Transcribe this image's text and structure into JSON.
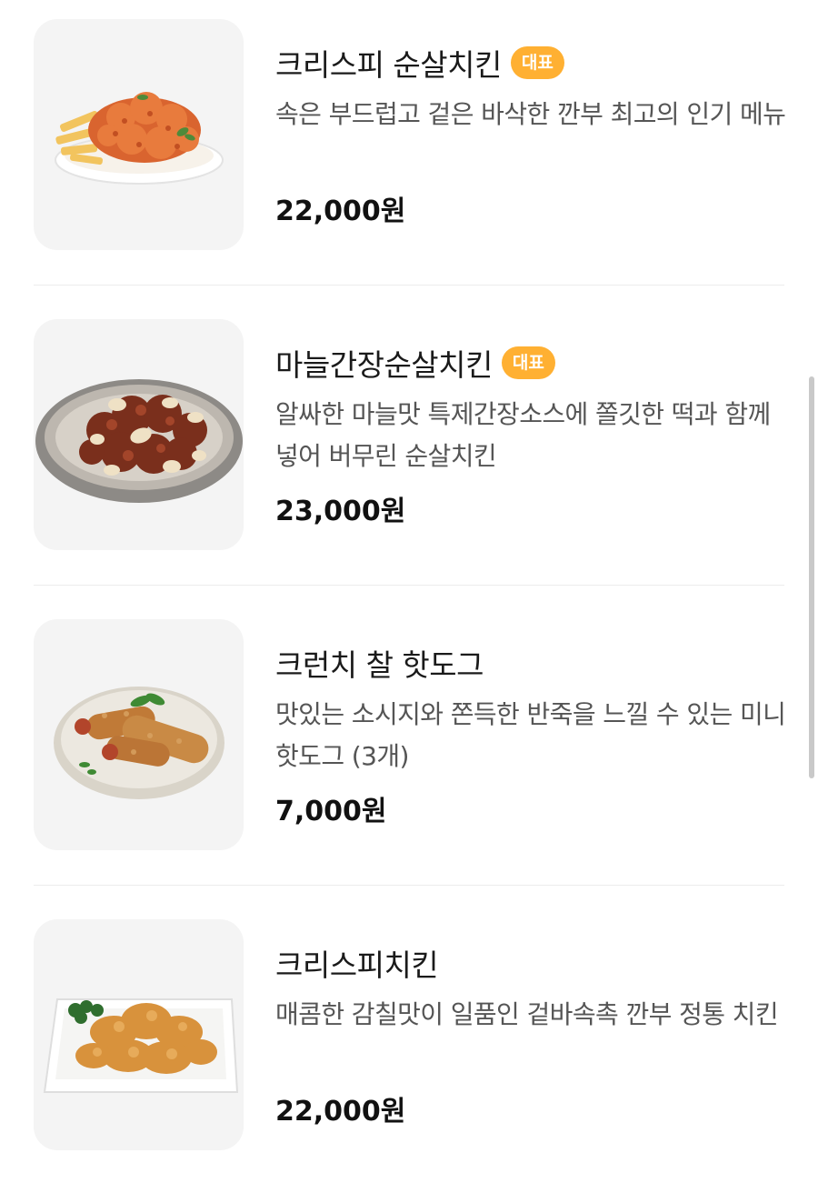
{
  "menu": {
    "items": [
      {
        "name": "크리스피 순살치킨",
        "badge": "대표",
        "description": "속은 부드럽고 겉은 바삭한 깐부 최고의 인기 메뉴",
        "price": "22,000원",
        "image_icon": "crispy-boneless-chicken-image"
      },
      {
        "name": "마늘간장순살치킨",
        "badge": "대표",
        "description": "알싸한 마늘맛 특제간장소스에 쫄깃한 떡과 함께 넣어 버무린 순살치킨",
        "price": "23,000원",
        "image_icon": "garlic-soy-boneless-chicken-image"
      },
      {
        "name": "크런치 찰 핫도그",
        "badge": "",
        "description": "맛있는 소시지와 쫀득한 반죽을 느낄 수 있는 미니 핫도그 (3개)",
        "price": "7,000원",
        "image_icon": "crunch-hotdog-image"
      },
      {
        "name": "크리스피치킨",
        "badge": "",
        "description": "매콤한 감칠맛이 일품인 겉바속촉 깐부 정통 치킨",
        "price": "22,000원",
        "image_icon": "crispy-chicken-image"
      }
    ]
  },
  "colors": {
    "badge_background": "#ffb032",
    "badge_text": "#ffffff",
    "thumbnail_background": "#f4f4f4",
    "divider": "#ececec"
  }
}
